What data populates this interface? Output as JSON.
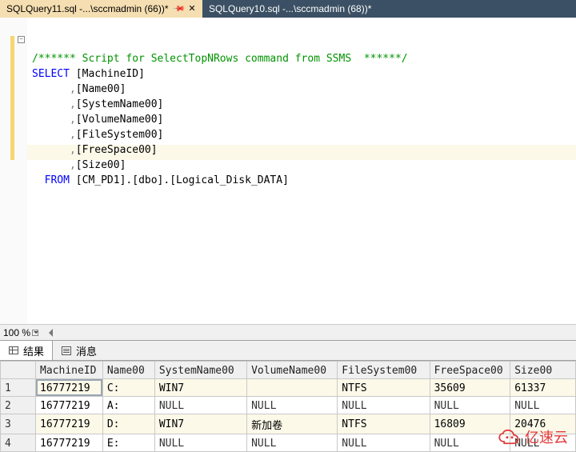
{
  "tabs": [
    {
      "label": "SQLQuery11.sql -...\\sccmadmin (66))*",
      "active": true,
      "pinned": true,
      "closable": true
    },
    {
      "label": "SQLQuery10.sql -...\\sccmadmin (68))*",
      "active": false,
      "pinned": false,
      "closable": false
    }
  ],
  "zoom": {
    "label": "100 %"
  },
  "sql": {
    "comment": "/****** Script for SelectTopNRows command from SSMS  ******/",
    "select_kw": "SELECT",
    "from_kw": "FROM",
    "columns": [
      "[MachineID]",
      "[Name00]",
      "[SystemName00]",
      "[VolumeName00]",
      "[FileSystem00]",
      "[FreeSpace00]",
      "[Size00]"
    ],
    "from_src": "[CM_PD1].[dbo].[Logical_Disk_DATA]"
  },
  "result_tabs": {
    "results": "结果",
    "messages": "消息"
  },
  "grid": {
    "columns": [
      "MachineID",
      "Name00",
      "SystemName00",
      "VolumeName00",
      "FileSystem00",
      "FreeSpace00",
      "Size00"
    ],
    "rows": [
      {
        "n": "1",
        "c": [
          "16777219",
          "C:",
          "WIN7",
          "",
          "NTFS",
          "35609",
          "61337"
        ]
      },
      {
        "n": "2",
        "c": [
          "16777219",
          "A:",
          "NULL",
          "NULL",
          "NULL",
          "NULL",
          "NULL"
        ]
      },
      {
        "n": "3",
        "c": [
          "16777219",
          "D:",
          "WIN7",
          "新加卷",
          "NTFS",
          "16809",
          "20476"
        ]
      },
      {
        "n": "4",
        "c": [
          "16777219",
          "E:",
          "NULL",
          "NULL",
          "NULL",
          "NULL",
          "NULL"
        ]
      }
    ],
    "null_token": "NULL"
  },
  "watermark": "亿速云"
}
